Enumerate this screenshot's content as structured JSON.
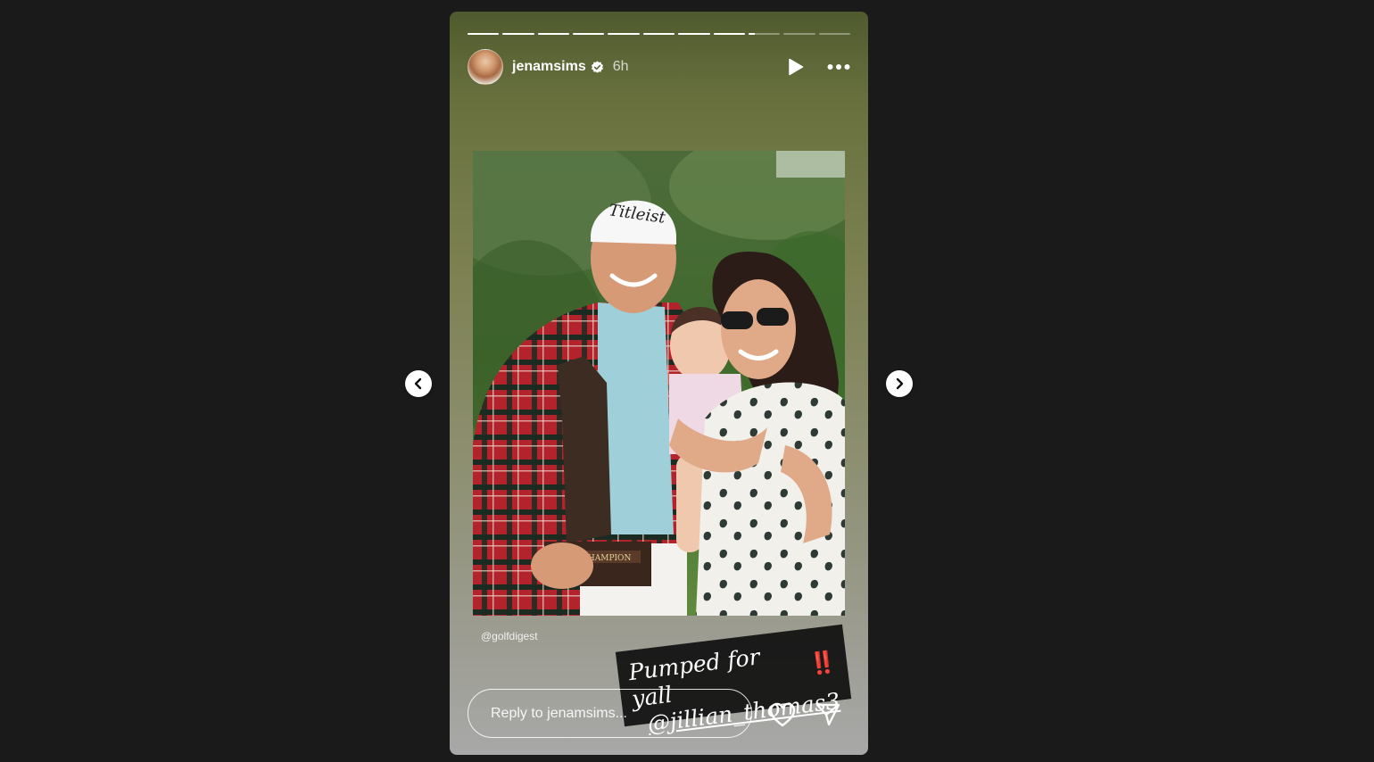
{
  "story": {
    "segments": [
      1,
      1,
      1,
      1,
      1,
      1,
      1,
      1,
      0.2,
      0,
      0
    ],
    "username": "jenamsims",
    "verified": true,
    "time": "6h",
    "photo_credit": "@golfdigest",
    "sticker": {
      "line1": "Pumped for yall",
      "emoji": "‼️",
      "line2": "@jillian_thomas3"
    },
    "photo_texts": {
      "cap_logo": "Titleist",
      "plaque": "CHAMPION"
    }
  },
  "reply": {
    "placeholder": "Reply to jenamsims..."
  },
  "icons": {
    "play": "play-icon",
    "more": "more-options-icon",
    "like": "heart-icon",
    "share": "send-icon",
    "prev": "chevron-left-icon",
    "next": "chevron-right-icon"
  }
}
